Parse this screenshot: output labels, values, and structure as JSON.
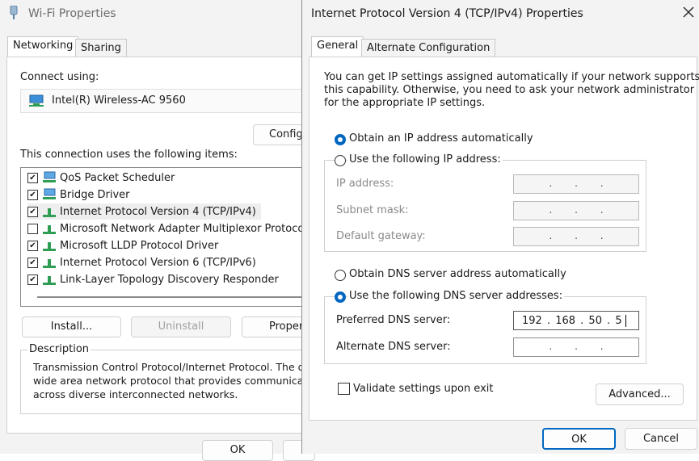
{
  "wifi": {
    "title": "Wi-Fi Properties",
    "tabs": [
      "Networking",
      "Sharing"
    ],
    "connect_using_label": "Connect using:",
    "adapter": "Intel(R) Wireless-AC 9560",
    "configure_button": "Configu",
    "items_label": "This connection uses the following items:",
    "items": [
      {
        "label": "QoS Packet Scheduler",
        "checked": true,
        "icon": "network-service-icon"
      },
      {
        "label": "Bridge Driver",
        "checked": true,
        "icon": "network-service-icon"
      },
      {
        "label": "Internet Protocol Version 4 (TCP/IPv4)",
        "checked": true,
        "icon": "protocol-icon",
        "selected": true
      },
      {
        "label": "Microsoft Network Adapter Multiplexor Protocol",
        "checked": false,
        "icon": "protocol-icon"
      },
      {
        "label": "Microsoft LLDP Protocol Driver",
        "checked": true,
        "icon": "protocol-icon"
      },
      {
        "label": "Internet Protocol Version 6 (TCP/IPv6)",
        "checked": true,
        "icon": "protocol-icon"
      },
      {
        "label": "Link-Layer Topology Discovery Responder",
        "checked": true,
        "icon": "protocol-icon"
      }
    ],
    "install_button": "Install...",
    "uninstall_button": "Uninstall",
    "properties_button": "Propert",
    "description_label": "Description",
    "description_lines": [
      "Transmission Control Protocol/Internet Protocol. The defa",
      "wide area network protocol that provides communication",
      "across diverse interconnected networks."
    ],
    "ok_button": "OK"
  },
  "ipv4": {
    "title": "Internet Protocol Version 4 (TCP/IPv4) Properties",
    "tabs": [
      "General",
      "Alternate Configuration"
    ],
    "intro_lines": [
      "You can get IP settings assigned automatically if your network supports",
      "this capability. Otherwise, you need to ask your network administrator",
      "for the appropriate IP settings."
    ],
    "obtain_ip_auto": "Obtain an IP address automatically",
    "use_following_ip": "Use the following IP address:",
    "ip_address_label": "IP address:",
    "subnet_mask_label": "Subnet mask:",
    "default_gateway_label": "Default gateway:",
    "obtain_dns_auto": "Obtain DNS server address automatically",
    "use_following_dns": "Use the following DNS server addresses:",
    "preferred_dns_label": "Preferred DNS server:",
    "preferred_dns_value": "192 . 168 . 50 . 5",
    "alternate_dns_label": "Alternate DNS server:",
    "empty_ip": ". . .",
    "validate_label": "Validate settings upon exit",
    "advanced_button": "Advanced...",
    "ok_button": "OK",
    "cancel_button": "Cancel"
  },
  "colors": {
    "accent": "#0067c0",
    "window_bg": "#f3f3f3"
  }
}
